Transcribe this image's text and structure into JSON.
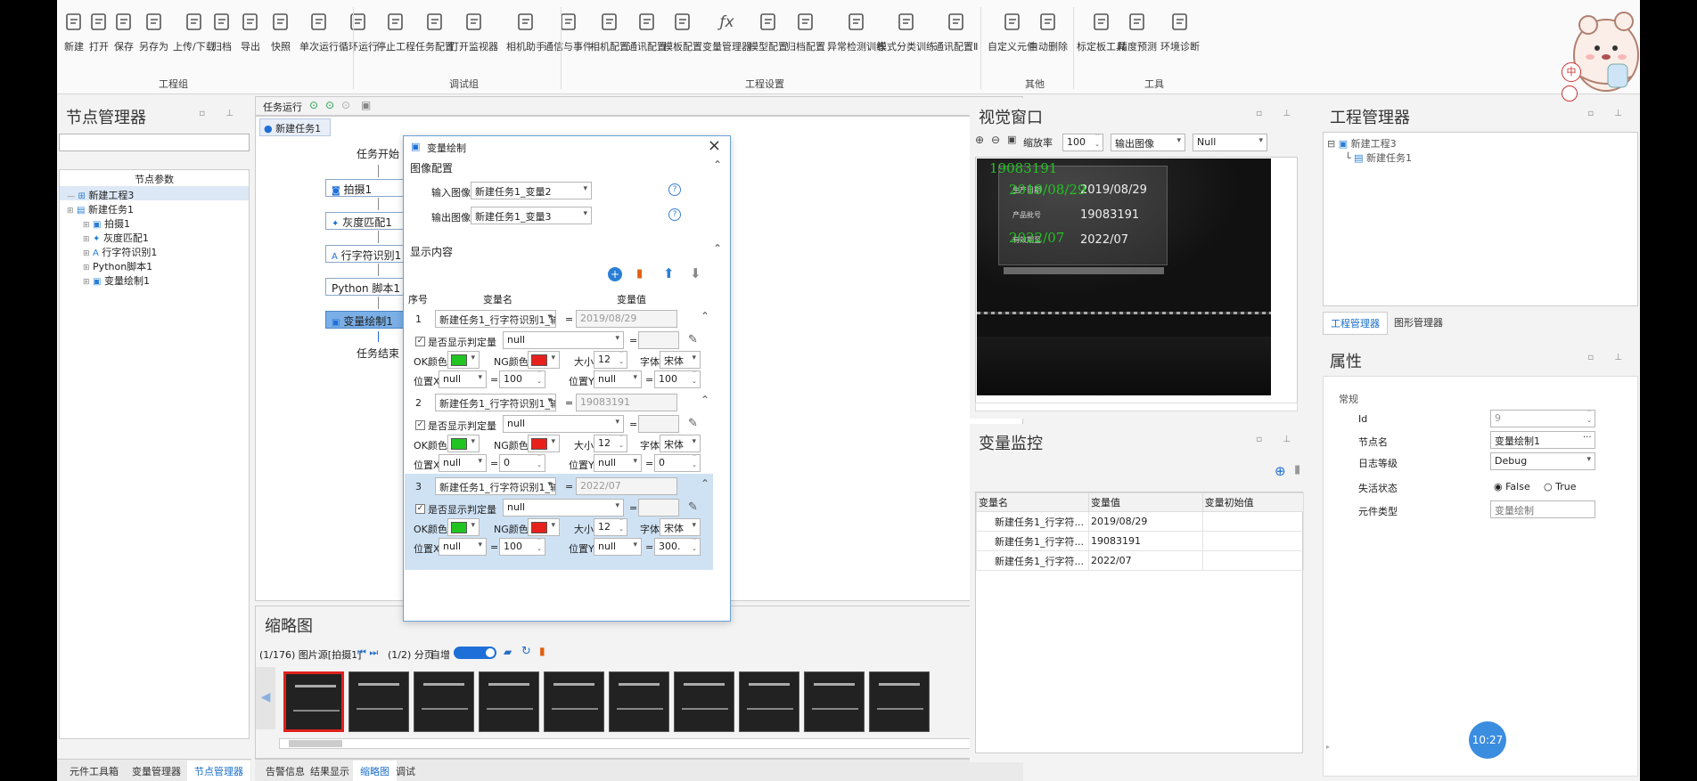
{
  "ribbon": {
    "buttons": [
      {
        "label": "新建",
        "icon": "new-icon"
      },
      {
        "label": "打开",
        "icon": "open-icon"
      },
      {
        "label": "保存",
        "icon": "save-icon"
      },
      {
        "label": "另存为",
        "icon": "save-as-icon"
      },
      {
        "label": "上传/下载",
        "icon": "upload-icon"
      },
      {
        "label": "归档",
        "icon": "archive-icon"
      },
      {
        "label": "导出",
        "icon": "export-icon"
      },
      {
        "label": "快照",
        "icon": "snapshot-icon"
      },
      {
        "label": "单次运行",
        "icon": "run-once-icon"
      },
      {
        "label": "循环运行",
        "icon": "loop-run-icon"
      },
      {
        "label": "停止工程",
        "icon": "stop-icon"
      },
      {
        "label": "任务配置",
        "icon": "task-config-icon"
      },
      {
        "label": "打开监视器",
        "icon": "monitor-icon"
      },
      {
        "label": "相机助手",
        "icon": "camera-helper-icon"
      },
      {
        "label": "通信与事件",
        "icon": "comm-event-icon"
      },
      {
        "label": "相机配置",
        "icon": "camera-config-icon"
      },
      {
        "label": "通讯配置",
        "icon": "network-icon"
      },
      {
        "label": "模板配置",
        "icon": "template-icon"
      },
      {
        "label": "变量管理器",
        "icon": "fx-icon"
      },
      {
        "label": "模型配置",
        "icon": "model-icon"
      },
      {
        "label": "归档配置",
        "icon": "archive-config-icon"
      },
      {
        "label": "异常检测训练",
        "icon": "anomaly-icon"
      },
      {
        "label": "模式分类训练",
        "icon": "classify-icon"
      },
      {
        "label": "通讯配置Ⅱ",
        "icon": "network2-icon"
      },
      {
        "label": "自定义元件",
        "icon": "custom-component-icon"
      },
      {
        "label": "自动删除",
        "icon": "auto-delete-icon"
      },
      {
        "label": "标定板工具",
        "icon": "calib-board-icon"
      },
      {
        "label": "精度预测",
        "icon": "precision-icon"
      },
      {
        "label": "环境诊断",
        "icon": "diagnose-icon"
      }
    ],
    "groups": [
      "工程组",
      "调试组",
      "工程设置",
      "其他",
      "工具"
    ]
  },
  "node_manager": {
    "title": "节点管理器",
    "header": "节点参数",
    "tree": [
      "新建工程3",
      "新建任务1",
      "拍摄1",
      "灰度匹配1",
      "行字符识别1",
      "Python脚本1",
      "变量绘制1"
    ]
  },
  "left_tabs": [
    "元件工具箱",
    "变量管理器",
    "节点管理器"
  ],
  "task": {
    "run_label": "任务运行",
    "tab": "新建任务1",
    "start": "任务开始",
    "end": "任务结束",
    "nodes": [
      "拍摄1",
      "灰度匹配1",
      "行字符识别1",
      "Python 脚本1",
      "变量绘制1"
    ]
  },
  "dialog": {
    "title": "变量绘制",
    "image_section": "图像配置",
    "input_label": "输入图像",
    "input_value": "新建任务1_变量2",
    "output_label": "输出图像",
    "output_value": "新建任务1_变量3",
    "display_section": "显示内容",
    "col_index": "序号",
    "col_name": "变量名",
    "col_value": "变量值",
    "show_label": "是否显示",
    "judge_label": "判定量",
    "ok_label": "OK颜色",
    "ng_label": "NG颜色",
    "size_label": "大小",
    "font_label": "字体",
    "posx_label": "位置X",
    "posy_label": "位置Y",
    "ok_color": "#22c422",
    "ng_color": "#e8201c",
    "rows": [
      {
        "index": "1",
        "name": "新建任务1_行字符识别1_输...",
        "value": "2019/08/29",
        "judge": "null",
        "size": "12",
        "font": "宋体",
        "x_src": "null",
        "x": "100",
        "y_src": "null",
        "y": "100"
      },
      {
        "index": "2",
        "name": "新建任务1_行字符识别1_输...",
        "value": "19083191",
        "judge": "null",
        "size": "12",
        "font": "宋体",
        "x_src": "null",
        "x": "0",
        "y_src": "null",
        "y": "0"
      },
      {
        "index": "3",
        "name": "新建任务1_行字符识别1_输...",
        "value": "2022/07",
        "judge": "null",
        "size": "12",
        "font": "宋体",
        "x_src": "null",
        "x": "100",
        "y_src": "null",
        "y": "300."
      }
    ]
  },
  "vision": {
    "title": "视觉窗口",
    "zoom_label": "缩放率",
    "zoom_value": "100",
    "output_select": "输出图像",
    "null_select": "Null",
    "image_texts": {
      "overlay1": "19083191",
      "overlay2": "2019/08/29",
      "overlay3": "2022/07",
      "label_prod_date": "生产日期",
      "date_printed": "2019/08/29",
      "label_batch": "产品批号",
      "batch_printed": "19083191",
      "label_expiry": "有效期至",
      "expiry_printed": "2022/07"
    }
  },
  "var_monitor": {
    "title": "变量监控",
    "columns": [
      "变量名",
      "变量值",
      "变量初始值"
    ],
    "rows": [
      {
        "name": "新建任务1_行字符...",
        "value": "2019/08/29",
        "init": ""
      },
      {
        "name": "新建任务1_行字符...",
        "value": "19083191",
        "init": ""
      },
      {
        "name": "新建任务1_行字符...",
        "value": "2022/07",
        "init": ""
      }
    ]
  },
  "project_manager": {
    "title": "工程管理器",
    "tree": [
      "新建工程3",
      "新建任务1"
    ],
    "tabs": [
      "工程管理器",
      "图形管理器"
    ]
  },
  "properties": {
    "title": "属性",
    "section": "常规",
    "id_label": "Id",
    "id_value": "9",
    "name_label": "节点名",
    "name_value": "变量绘制1",
    "log_label": "日志等级",
    "log_value": "Debug",
    "enabled_label": "失活状态",
    "opt_false": "False",
    "opt_true": "True",
    "type_label": "元件类型",
    "type_value": "变量绘制"
  },
  "thumbnails": {
    "title": "缩略图",
    "info": "(1/176) 图片源[拍摄1]",
    "page": "(1/2) 分页",
    "auto": "自增",
    "count": 10
  },
  "bottom_tabs": [
    "告警信息",
    "结果显示",
    "缩略图",
    "调试"
  ],
  "clock": "10:27",
  "mascot_badges": [
    "中"
  ]
}
